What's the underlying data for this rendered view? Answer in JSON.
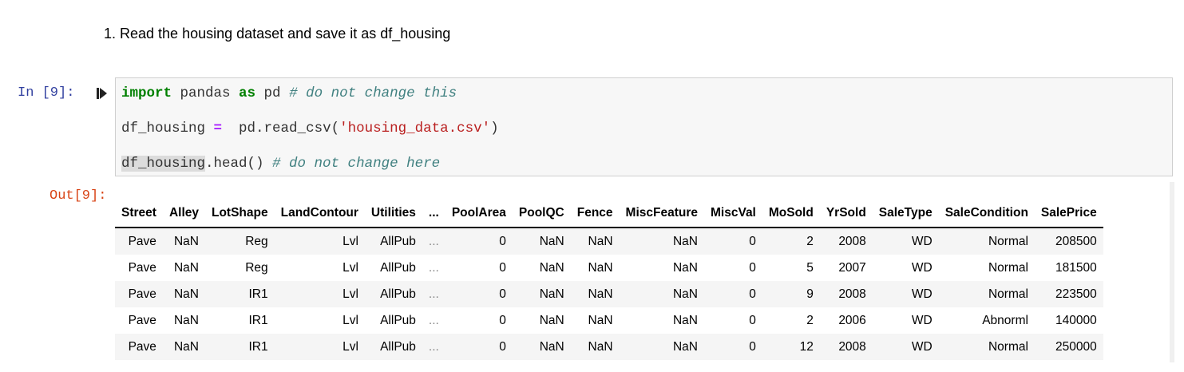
{
  "markdown": {
    "text": "1. Read the housing dataset and save it as df_housing"
  },
  "cell": {
    "in_prompt": "In [9]:",
    "out_prompt": "Out[9]:",
    "code": {
      "line1": {
        "kw_import": "import",
        "mod": " pandas ",
        "kw_as": "as",
        "alias": " pd ",
        "comment": "# do not change this"
      },
      "line2": {
        "lhs": "df_housing ",
        "op": "=",
        "call": "  pd.read_csv(",
        "str": "'housing_data.csv'",
        "close": ")"
      },
      "line3": {
        "var": "df_housing",
        "rest": ".head() ",
        "comment": "# do not change here"
      }
    }
  },
  "table": {
    "columns": [
      "Street",
      "Alley",
      "LotShape",
      "LandContour",
      "Utilities",
      "...",
      "PoolArea",
      "PoolQC",
      "Fence",
      "MiscFeature",
      "MiscVal",
      "MoSold",
      "YrSold",
      "SaleType",
      "SaleCondition",
      "SalePrice"
    ],
    "rows": [
      [
        "Pave",
        "NaN",
        "Reg",
        "Lvl",
        "AllPub",
        "...",
        "0",
        "NaN",
        "NaN",
        "NaN",
        "0",
        "2",
        "2008",
        "WD",
        "Normal",
        "208500"
      ],
      [
        "Pave",
        "NaN",
        "Reg",
        "Lvl",
        "AllPub",
        "...",
        "0",
        "NaN",
        "NaN",
        "NaN",
        "0",
        "5",
        "2007",
        "WD",
        "Normal",
        "181500"
      ],
      [
        "Pave",
        "NaN",
        "IR1",
        "Lvl",
        "AllPub",
        "...",
        "0",
        "NaN",
        "NaN",
        "NaN",
        "0",
        "9",
        "2008",
        "WD",
        "Normal",
        "223500"
      ],
      [
        "Pave",
        "NaN",
        "IR1",
        "Lvl",
        "AllPub",
        "...",
        "0",
        "NaN",
        "NaN",
        "NaN",
        "0",
        "2",
        "2006",
        "WD",
        "Abnorml",
        "140000"
      ],
      [
        "Pave",
        "NaN",
        "IR1",
        "Lvl",
        "AllPub",
        "...",
        "0",
        "NaN",
        "NaN",
        "NaN",
        "0",
        "12",
        "2008",
        "WD",
        "Normal",
        "250000"
      ]
    ]
  },
  "icons": {
    "run": "run-cell-icon"
  },
  "colors": {
    "in_prompt": "#303f9f",
    "out_prompt": "#d84315",
    "keyword": "#008000",
    "string": "#ba2121",
    "comment": "#408080",
    "operator": "#aa22ff"
  }
}
